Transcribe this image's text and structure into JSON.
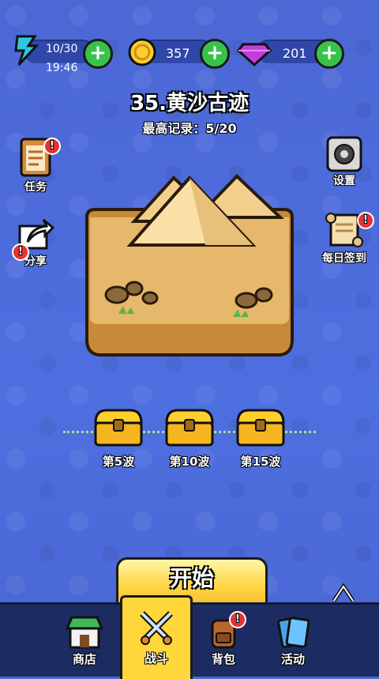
{
  "stats": {
    "energy": "10/30",
    "timer": "19:46",
    "coins": "357",
    "gems": "201"
  },
  "level": {
    "title": "35.黄沙古迹",
    "record": "最高记录：5/20"
  },
  "side_buttons": {
    "task": "任务",
    "share": "分享",
    "settings": "设置",
    "daily_signin": "每日签到"
  },
  "rewards": [
    {
      "label": "第5波"
    },
    {
      "label": "第10波"
    },
    {
      "label": "第15波"
    }
  ],
  "start_label": "开始",
  "nav": {
    "shop": "商店",
    "battle": "战斗",
    "bag": "背包",
    "activity": "活动"
  },
  "badge_mark": "!",
  "colors": {
    "background": "#4a6bd6",
    "accent_yellow": "#ffd63c",
    "plus_green": "#39c24a",
    "badge_red": "#e83232"
  }
}
